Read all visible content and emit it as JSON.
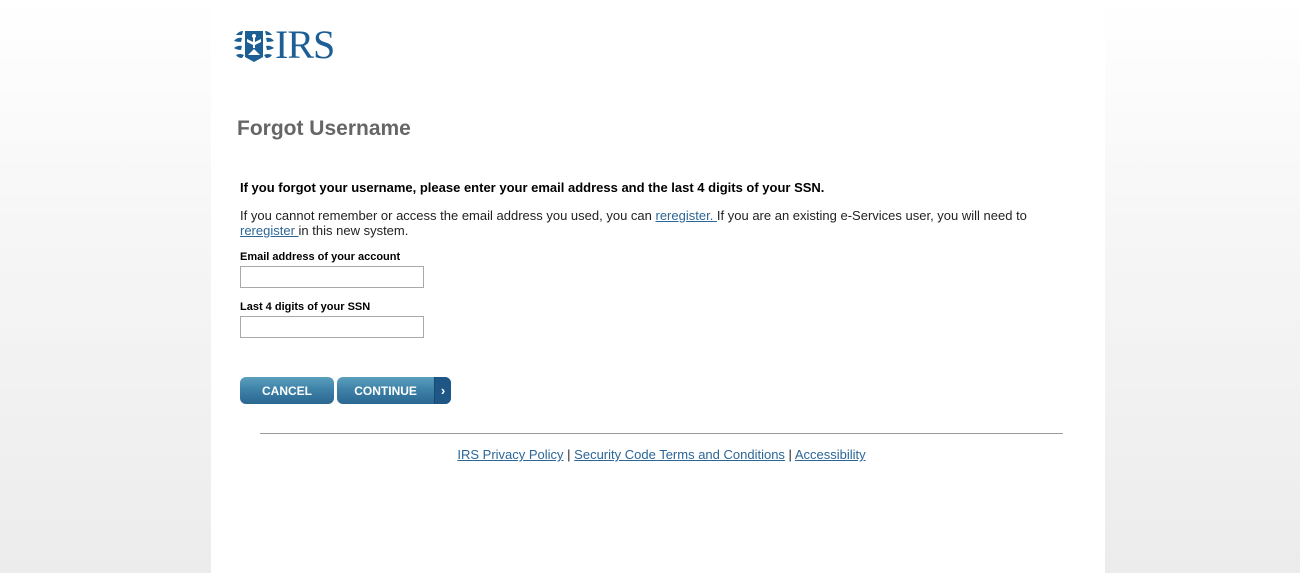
{
  "logo": {
    "text": "IRS",
    "icon": "irs-eagle-logo-icon"
  },
  "page": {
    "title": "Forgot Username",
    "intro": "If you forgot your username, please enter your email address and the last 4 digits of your SSN.",
    "help": {
      "part1": "If you cannot remember or access the email address you used, you can ",
      "link1": "reregister. ",
      "part2": "If you are an existing e-Services user, you will need to ",
      "link2": "reregister ",
      "part3": "in this new system."
    }
  },
  "form": {
    "email": {
      "label": "Email address of your account",
      "value": "",
      "placeholder": ""
    },
    "ssn": {
      "label": "Last 4 digits of your SSN",
      "value": "",
      "placeholder": ""
    }
  },
  "buttons": {
    "cancel": "CANCEL",
    "continue": "CONTINUE",
    "continue_arrow": "›"
  },
  "footer": {
    "links": [
      "IRS Privacy Policy",
      "Security Code Terms and Conditions",
      "Accessibility"
    ],
    "separator": " | "
  },
  "colors": {
    "brand": "#1d5f94",
    "link": "#2c6697",
    "button": "#3f82a8",
    "title": "#666666"
  }
}
